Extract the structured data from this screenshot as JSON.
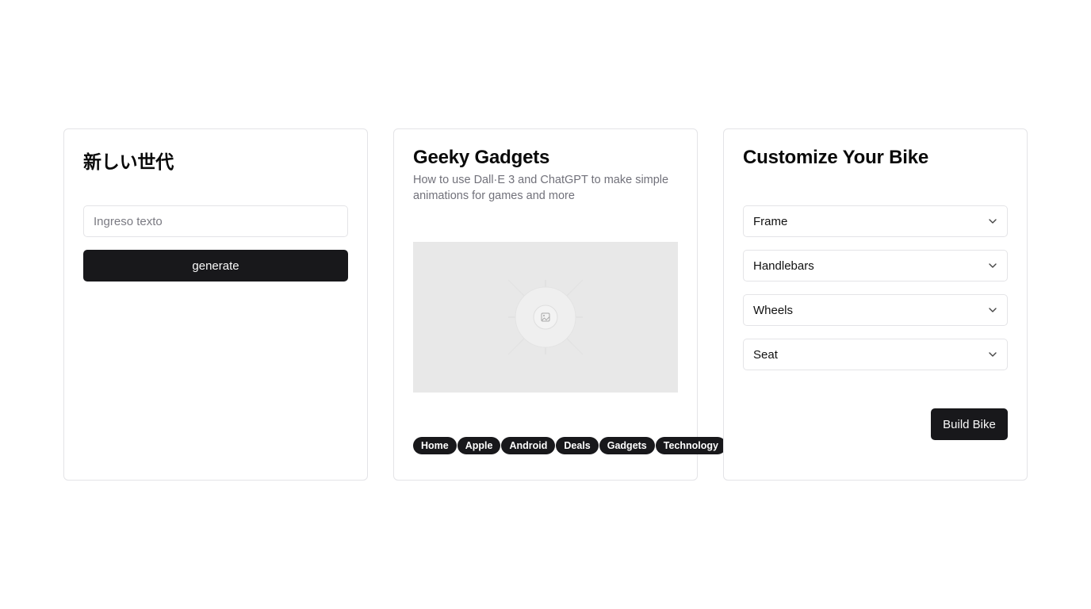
{
  "generator_card": {
    "title": "新しい世代",
    "input_placeholder": "Ingreso texto",
    "input_value": "",
    "button_label": "generate"
  },
  "news_card": {
    "title": "Geeky Gadgets",
    "description": "How to use Dall·E 3 and ChatGPT to make simple animations for games and more",
    "image_icon": "image-icon",
    "tags": [
      "Home",
      "Apple",
      "Android",
      "Deals",
      "Gadgets",
      "Technology"
    ]
  },
  "bike_card": {
    "title": "Customize Your Bike",
    "selects": [
      "Frame",
      "Handlebars",
      "Wheels",
      "Seat"
    ],
    "select_icon": "chevron-down-icon",
    "button_label": "Build Bike"
  }
}
